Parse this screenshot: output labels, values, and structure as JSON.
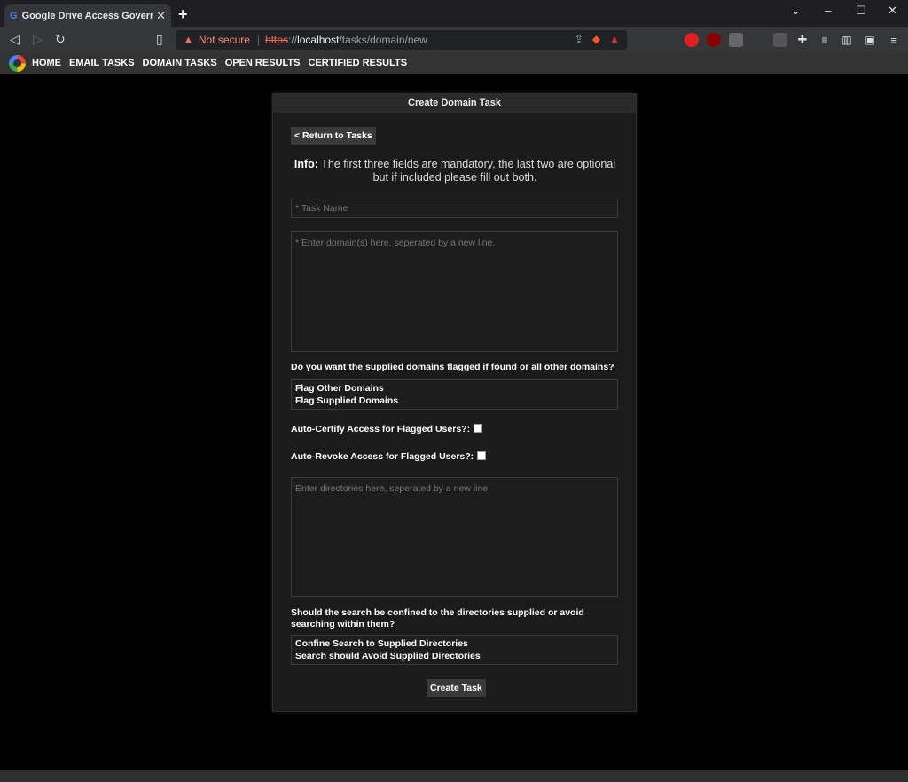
{
  "browser": {
    "tab_title": "Google Drive Access Governance",
    "tab_close": "✕",
    "new_tab": "+",
    "security_label": "Not secure",
    "url_scheme": "https",
    "url_sep": "://",
    "url_host": "localhost",
    "url_path": "/tasks/domain/new"
  },
  "nav": {
    "items": [
      "HOME",
      "EMAIL TASKS",
      "DOMAIN TASKS",
      "OPEN RESULTS",
      "CERTIFIED RESULTS"
    ]
  },
  "form": {
    "title": "Create Domain Task",
    "return_button": "< Return to Tasks",
    "info_prefix": "Info:",
    "info_text": " The first three fields are mandatory, the last two are optional but if included please fill out both.",
    "task_name_placeholder": "* Task Name",
    "domains_placeholder": "* Enter domain(s) here, seperated by a new line.",
    "flag_question": "Do you want the supplied domains flagged if found or all other domains?",
    "flag_options": [
      "Flag Other Domains",
      "Flag Supplied Domains"
    ],
    "auto_certify_label": "Auto-Certify Access for Flagged Users?:",
    "auto_revoke_label": "Auto-Revoke Access for Flagged Users?:",
    "directories_placeholder": "Enter directories here, seperated by a new line.",
    "confine_question": "Should the search be confined to the directories supplied or avoid searching within them?",
    "confine_options": [
      "Confine Search to Supplied Directories",
      "Search should Avoid Supplied Directories"
    ],
    "submit_button": "Create Task"
  }
}
